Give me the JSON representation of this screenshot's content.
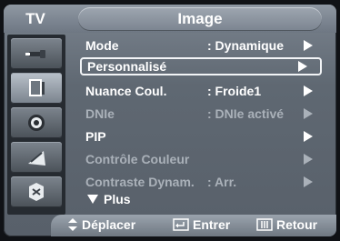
{
  "header": {
    "tv_label": "TV",
    "title": "Image"
  },
  "sidebar": {
    "items": [
      {
        "icon": "input-plug-icon"
      },
      {
        "icon": "picture-icon"
      },
      {
        "icon": "speaker-icon"
      },
      {
        "icon": "satellite-dish-icon"
      },
      {
        "icon": "setup-icon"
      }
    ]
  },
  "menu": {
    "rows": [
      {
        "label": "Mode",
        "value": ": Dynamique",
        "enabled": true,
        "selected": false
      },
      {
        "label": "Personnalisé",
        "value": "",
        "enabled": true,
        "selected": true
      },
      {
        "label": "Nuance Coul.",
        "value": ": Froide1",
        "enabled": true,
        "selected": false
      },
      {
        "label": "DNIe",
        "value": ": DNIe activé",
        "enabled": false,
        "selected": false
      },
      {
        "label": "PIP",
        "value": "",
        "enabled": true,
        "selected": false
      },
      {
        "label": "Contrôle Couleur",
        "value": "",
        "enabled": false,
        "selected": false
      },
      {
        "label": "Contraste Dynam.",
        "value": ": Arr.",
        "enabled": false,
        "selected": false
      }
    ],
    "more_label": "Plus"
  },
  "footer": {
    "move_label": "Déplacer",
    "enter_label": "Entrer",
    "return_label": "Retour"
  }
}
